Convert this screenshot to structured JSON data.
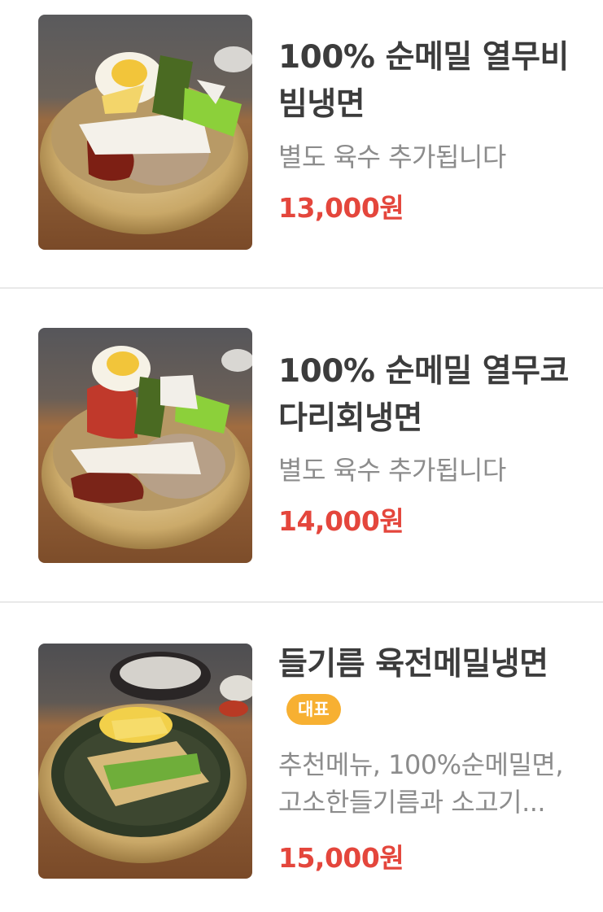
{
  "menu": {
    "items": [
      {
        "image_alt": "bibim-naengmyeon-photo",
        "title_lines": [
          "100% 순메밀 열무비",
          "빔냉면"
        ],
        "desc_lines": [
          "별도 육수 추가됩니다"
        ],
        "price": "13,000원"
      },
      {
        "image_alt": "hoe-naengmyeon-photo",
        "title_lines": [
          "100% 순메밀 열무코",
          "다리회냉면"
        ],
        "desc_lines": [
          "별도 육수 추가됩니다"
        ],
        "price": "14,000원"
      },
      {
        "image_alt": "perilla-oil-naengmyeon-photo",
        "title_lines": [
          "들기름 육전메밀냉면"
        ],
        "badge": "대표",
        "desc_lines": [
          "추천메뉴, 100%순메밀면,",
          "고소한들기름과 소고기..."
        ],
        "price": "15,000원"
      }
    ]
  },
  "colors": {
    "title": "#3c3c3c",
    "description": "#8c8c8c",
    "price": "#e4463c",
    "badge": "#f7b032",
    "divider": "#e9e9e9"
  }
}
